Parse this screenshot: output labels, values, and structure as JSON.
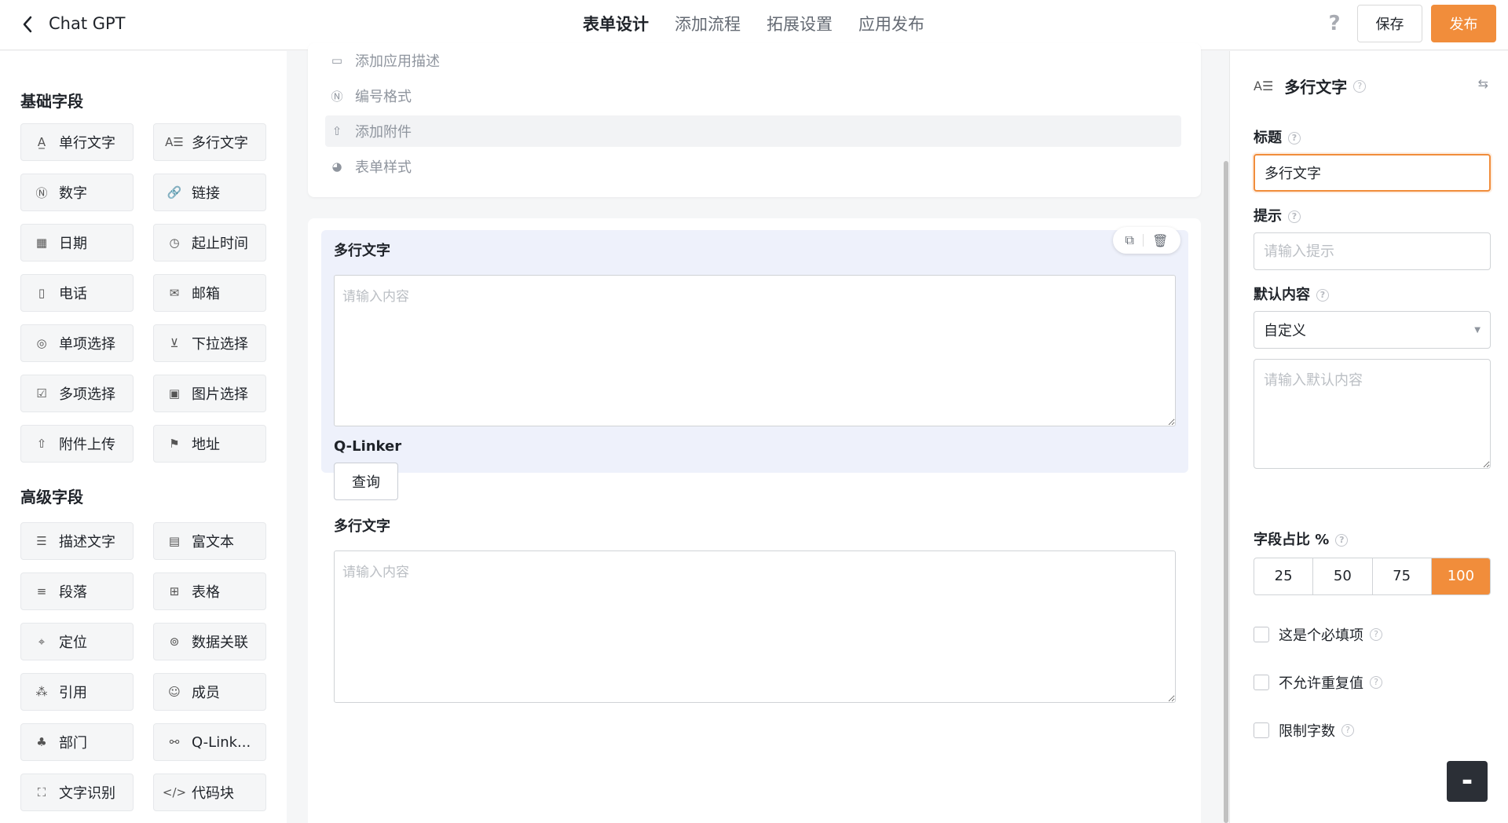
{
  "header": {
    "app_title": "Chat GPT",
    "tabs": [
      {
        "label": "表单设计",
        "active": true
      },
      {
        "label": "添加流程",
        "active": false
      },
      {
        "label": "拓展设置",
        "active": false
      },
      {
        "label": "应用发布",
        "active": false
      }
    ],
    "help": "?",
    "save_label": "保存",
    "publish_label": "发布"
  },
  "left": {
    "basic_title": "基础字段",
    "basic_fields": [
      {
        "label": "单行文字",
        "icon": "single-line-text-icon",
        "glyph": "A̲"
      },
      {
        "label": "多行文字",
        "icon": "multi-line-text-icon",
        "glyph": "A☰"
      },
      {
        "label": "数字",
        "icon": "number-icon",
        "glyph": "Ⓝ"
      },
      {
        "label": "链接",
        "icon": "link-icon",
        "glyph": "🔗"
      },
      {
        "label": "日期",
        "icon": "calendar-icon",
        "glyph": "▦"
      },
      {
        "label": "起止时间",
        "icon": "time-range-icon",
        "glyph": "◷"
      },
      {
        "label": "电话",
        "icon": "phone-icon",
        "glyph": "▯"
      },
      {
        "label": "邮箱",
        "icon": "mail-icon",
        "glyph": "✉"
      },
      {
        "label": "单项选择",
        "icon": "radio-icon",
        "glyph": "◎"
      },
      {
        "label": "下拉选择",
        "icon": "dropdown-icon",
        "glyph": "⊻"
      },
      {
        "label": "多项选择",
        "icon": "checkbox-icon",
        "glyph": "☑"
      },
      {
        "label": "图片选择",
        "icon": "image-icon",
        "glyph": "▣"
      },
      {
        "label": "附件上传",
        "icon": "upload-icon",
        "glyph": "⇧"
      },
      {
        "label": "地址",
        "icon": "address-icon",
        "glyph": "⚑"
      }
    ],
    "advanced_title": "高级字段",
    "advanced_fields": [
      {
        "label": "描述文字",
        "icon": "description-icon",
        "glyph": "☰"
      },
      {
        "label": "富文本",
        "icon": "rich-text-icon",
        "glyph": "▤"
      },
      {
        "label": "段落",
        "icon": "paragraph-icon",
        "glyph": "≡"
      },
      {
        "label": "表格",
        "icon": "table-icon",
        "glyph": "⊞"
      },
      {
        "label": "定位",
        "icon": "location-icon",
        "glyph": "⌖"
      },
      {
        "label": "数据关联",
        "icon": "data-link-icon",
        "glyph": "⊚"
      },
      {
        "label": "引用",
        "icon": "reference-icon",
        "glyph": "⁂"
      },
      {
        "label": "成员",
        "icon": "member-icon",
        "glyph": "☺"
      },
      {
        "label": "部门",
        "icon": "department-icon",
        "glyph": "♣"
      },
      {
        "label": "Q-Link...",
        "icon": "q-linker-icon",
        "glyph": "⚯"
      },
      {
        "label": "文字识别",
        "icon": "ocr-icon",
        "glyph": "⛶"
      },
      {
        "label": "代码块",
        "icon": "code-icon",
        "glyph": "</>"
      }
    ]
  },
  "center": {
    "options": [
      {
        "label": "添加应用描述",
        "icon": "comment-icon",
        "glyph": "▭"
      },
      {
        "label": "编号格式",
        "icon": "number-format-icon",
        "glyph": "Ⓝ"
      },
      {
        "label": "添加附件",
        "icon": "upload-icon",
        "glyph": "⇧"
      },
      {
        "label": "表单样式",
        "icon": "palette-icon",
        "glyph": "◕"
      }
    ],
    "field1": {
      "label": "多行文字",
      "placeholder": "请输入内容"
    },
    "qlinker": {
      "label": "Q-Linker",
      "button": "查询"
    },
    "field2": {
      "label": "多行文字",
      "placeholder": "请输入内容"
    },
    "copy_icon": "copy-icon",
    "delete_icon": "delete-icon"
  },
  "right": {
    "header_title": "多行文字",
    "title_label": "标题",
    "title_value": "多行文字",
    "hint_label": "提示",
    "hint_placeholder": "请输入提示",
    "default_label": "默认内容",
    "default_select": "自定义",
    "default_placeholder": "请输入默认内容",
    "ratio_label": "字段占比 %",
    "ratio_options": [
      "25",
      "50",
      "75",
      "100"
    ],
    "ratio_selected": "100",
    "checks": [
      "这是个必填项",
      "不允许重复值",
      "限制字数"
    ]
  },
  "colors": {
    "accent": "#f18d3b",
    "selected_block": "#eef1fb"
  }
}
